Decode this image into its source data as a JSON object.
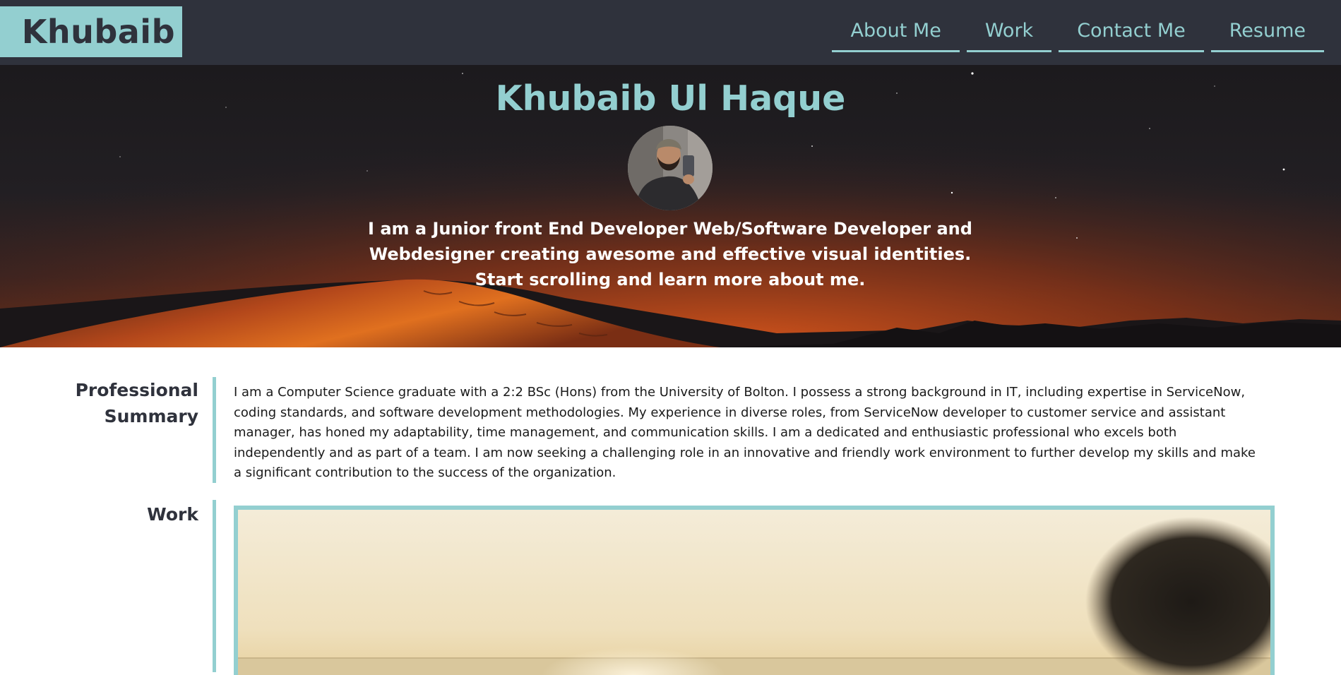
{
  "header": {
    "logo": "Khubaib",
    "nav": [
      {
        "label": "About Me"
      },
      {
        "label": "Work"
      },
      {
        "label": "Contact Me"
      },
      {
        "label": "Resume"
      }
    ]
  },
  "hero": {
    "title": "Khubaib Ul Haque",
    "tagline": "I am a Junior front End Developer Web/Software Developer and Webdesigner creating awesome and effective visual identities. Start scrolling and learn more about me."
  },
  "summary": {
    "label": "Professional Summary",
    "text": "I am a Computer Science graduate with a 2:2 BSc (Hons) from the University of Bolton. I possess a strong background in IT, including expertise in ServiceNow, coding standards, and software development methodologies. My experience in diverse roles, from ServiceNow developer to customer service and assistant manager, has honed my adaptability, time management, and communication skills. I am a dedicated and enthusiastic professional who excels both independently and as part of a team. I am now seeking a challenging role in an innovative and friendly work environment to further develop my skills and make a significant contribution to the success of the organization."
  },
  "work": {
    "label": "Work"
  },
  "colors": {
    "accent": "#93cfd0",
    "header_bg": "#2f323c",
    "text_dark": "#2f323c"
  }
}
